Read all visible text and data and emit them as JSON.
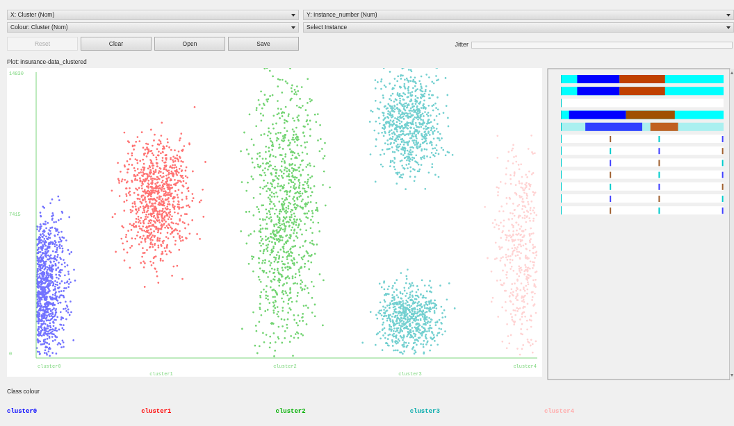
{
  "x_axis_select": {
    "value": "X: Cluster (Nom)"
  },
  "y_axis_select": {
    "value": "Y: Instance_number (Num)"
  },
  "colour_select": {
    "value": "Colour: Cluster (Nom)"
  },
  "instance_select": {
    "value": "Select Instance"
  },
  "buttons": [
    {
      "label": "Reset",
      "disabled": true
    },
    {
      "label": "Clear",
      "disabled": false
    },
    {
      "label": "Open",
      "disabled": false
    },
    {
      "label": "Save",
      "disabled": false
    }
  ],
  "jitter": {
    "label": "Jitter",
    "level": 0
  },
  "plot": {
    "title": "Plot: insurance-data_clustered",
    "y_ticks": [
      "14830",
      "7415",
      "0"
    ],
    "x_labels": [
      "cluster0",
      "cluster1",
      "cluster2",
      "cluster3",
      "cluster4"
    ]
  },
  "class_colour": {
    "title": "Class colour",
    "classes": [
      {
        "label": "cluster0",
        "color": "#0000ff"
      },
      {
        "label": "cluster1",
        "color": "#ff0000"
      },
      {
        "label": "cluster2",
        "color": "#00b000"
      },
      {
        "label": "cluster3",
        "color": "#00aaaa"
      },
      {
        "label": "cluster4",
        "color": "#ffafaf"
      }
    ]
  }
}
